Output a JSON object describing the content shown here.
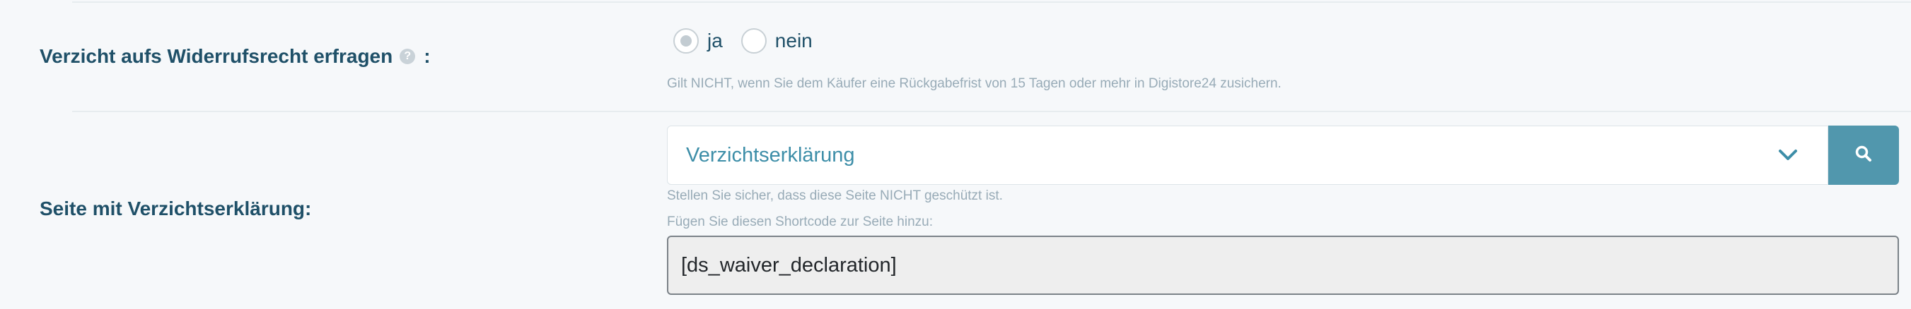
{
  "waiver_row": {
    "label": "Verzicht aufs Widerrufsrecht erfragen",
    "help_symbol": "?",
    "colon": ":",
    "options": [
      {
        "label": "ja",
        "selected": true
      },
      {
        "label": "nein",
        "selected": false
      }
    ],
    "hint": "Gilt NICHT, wenn Sie dem Käufer eine Rückgabefrist von 15 Tagen oder mehr in Digistore24 zusichern."
  },
  "declaration_row": {
    "label": "Seite mit Verzichtserklärung:",
    "select_value": "Verzichtserklärung",
    "hint_protected": "Stellen Sie sicher, dass diese Seite NICHT geschützt ist.",
    "hint_shortcode": "Fügen Sie diesen Shortcode zur Seite hinzu:",
    "shortcode": "[ds_waiver_declaration]"
  },
  "icons": {
    "help": "question-circle-icon",
    "dropdown": "chevron-down-icon",
    "search": "search-icon"
  },
  "colors": {
    "label_text": "#1f5068",
    "accent": "#5197ad",
    "select_text": "#3d8ea8",
    "hint_text": "#98abb7",
    "background": "#f6f8fa"
  }
}
